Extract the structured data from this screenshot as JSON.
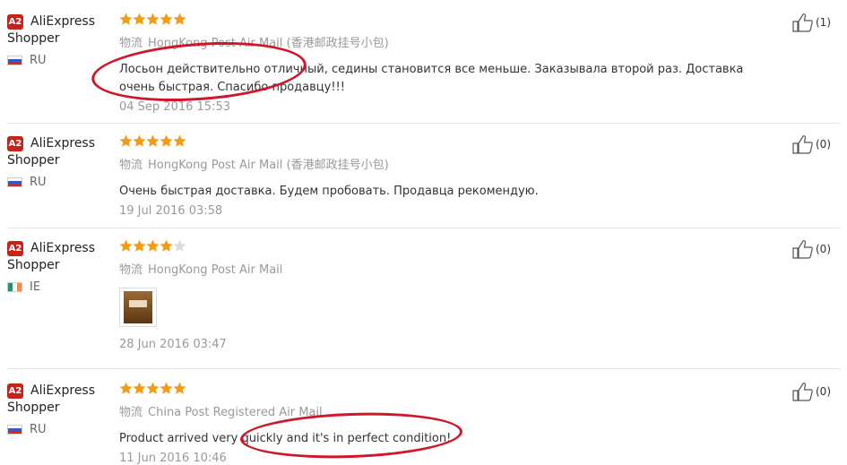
{
  "reviews": [
    {
      "badge": "A2",
      "user_line1": "AliExpress",
      "user_line2": "Shopper",
      "country": "RU",
      "stars": 5,
      "logistics_label": "物流",
      "logistics": "HongKong Post Air Mail (香港邮政挂号小包)",
      "text": "Лосьон действительно отличный, седины становится все меньше. Заказывала второй раз. Доставка очень быстрая. Спасибо продавцу!!!",
      "date": "04 Sep 2016 15:53",
      "helpful": "(1)"
    },
    {
      "badge": "A2",
      "user_line1": "AliExpress",
      "user_line2": "Shopper",
      "country": "RU",
      "stars": 5,
      "logistics_label": "物流",
      "logistics": "HongKong Post Air Mail (香港邮政挂号小包)",
      "text": "Очень быстрая доставка. Будем пробовать. Продавца рекомендую.",
      "date": "19 Jul 2016 03:58",
      "helpful": "(0)"
    },
    {
      "badge": "A2",
      "user_line1": "AliExpress",
      "user_line2": "Shopper",
      "country": "IE",
      "stars": 4,
      "logistics_label": "物流",
      "logistics": "HongKong Post Air Mail",
      "text": "",
      "date": "28 Jun 2016 03:47",
      "helpful": "(0)"
    },
    {
      "badge": "A2",
      "user_line1": "AliExpress",
      "user_line2": "Shopper",
      "country": "RU",
      "stars": 5,
      "logistics_label": "物流",
      "logistics": "China Post Registered Air Mail",
      "text": "Product arrived very quickly and it's in perfect condition!",
      "date": "11 Jun 2016 10:46",
      "helpful": "(0)"
    }
  ],
  "colors": {
    "star_filled": "#f39c12",
    "star_empty": "#dddddd",
    "annotation": "#d0162a",
    "badge": "#c8231a"
  }
}
